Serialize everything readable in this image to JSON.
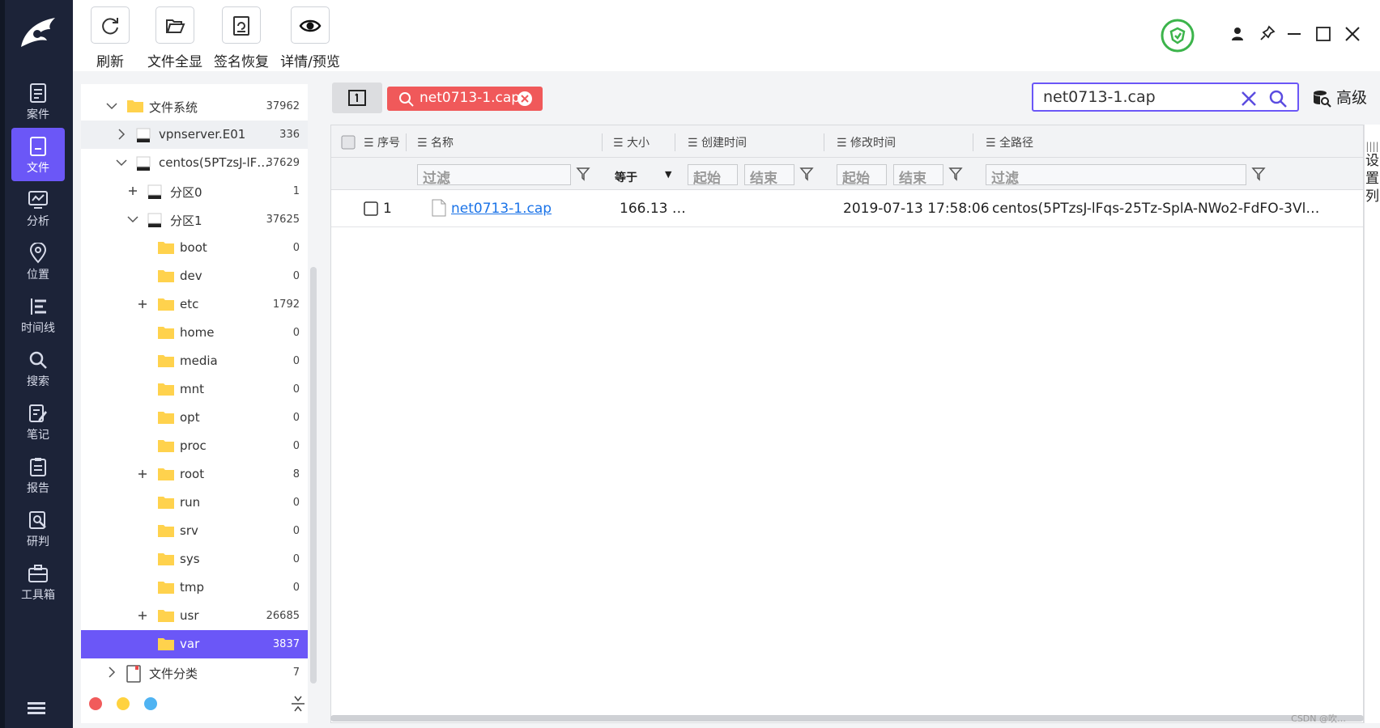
{
  "nav": {
    "items": [
      {
        "label": "案件",
        "icon": "case-icon"
      },
      {
        "label": "文件",
        "icon": "file-icon",
        "active": true
      },
      {
        "label": "分析",
        "icon": "analysis-icon"
      },
      {
        "label": "位置",
        "icon": "location-icon"
      },
      {
        "label": "时间线",
        "icon": "timeline-icon"
      },
      {
        "label": "搜索",
        "icon": "search-icon"
      },
      {
        "label": "笔记",
        "icon": "note-icon"
      },
      {
        "label": "报告",
        "icon": "report-icon"
      },
      {
        "label": "研判",
        "icon": "judge-icon"
      },
      {
        "label": "工具箱",
        "icon": "toolbox-icon"
      }
    ]
  },
  "toolbar": {
    "refresh": "刷新",
    "show_all": "文件全显",
    "sig_recover": "签名恢复",
    "detail_preview": "详情/预览"
  },
  "tree": {
    "items": [
      {
        "label": "文件系统",
        "count": "37962"
      },
      {
        "label": "vpnserver.E01",
        "count": "336"
      },
      {
        "label": "centos(5PTzsJ-lF…",
        "count": "37629"
      },
      {
        "label": "分区0",
        "count": "1"
      },
      {
        "label": "分区1",
        "count": "37625"
      },
      {
        "label": "boot",
        "count": "0"
      },
      {
        "label": "dev",
        "count": "0"
      },
      {
        "label": "etc",
        "count": "1792"
      },
      {
        "label": "home",
        "count": "0"
      },
      {
        "label": "media",
        "count": "0"
      },
      {
        "label": "mnt",
        "count": "0"
      },
      {
        "label": "opt",
        "count": "0"
      },
      {
        "label": "proc",
        "count": "0"
      },
      {
        "label": "root",
        "count": "8"
      },
      {
        "label": "run",
        "count": "0"
      },
      {
        "label": "srv",
        "count": "0"
      },
      {
        "label": "sys",
        "count": "0"
      },
      {
        "label": "tmp",
        "count": "0"
      },
      {
        "label": "usr",
        "count": "26685"
      },
      {
        "label": "var",
        "count": "3837"
      },
      {
        "label": "文件分类",
        "count": "7"
      }
    ]
  },
  "filter": {
    "chip": "net0713-1.cap",
    "search_value": "net0713-1.cap",
    "advanced": "高级"
  },
  "grid": {
    "headers": {
      "seq": "序号",
      "name": "名称",
      "size": "大小",
      "created": "创建时间",
      "modified": "修改时间",
      "path": "全路径"
    },
    "filter_row": {
      "name": "过滤",
      "size_op": "等于",
      "created_start": "起始",
      "created_end": "结束",
      "modified_start": "起始",
      "modified_end": "结束",
      "path": "过滤"
    },
    "rows": [
      {
        "seq": "1",
        "name": "net0713-1.cap",
        "size": "166.13 …",
        "created": "",
        "modified": "2019-07-13 17:58:06",
        "path": "centos(5PTzsJ-lFqs-25Tz-SplA-NWo2-FdFO-3Vl…"
      }
    ],
    "side_config": "设置列"
  },
  "watermark": "CSDN @吹…",
  "colors": {
    "accent": "#6b57f7",
    "chip": "#f0595a",
    "nav_bg": "#1c2338",
    "status_green": "#3cb44b"
  }
}
